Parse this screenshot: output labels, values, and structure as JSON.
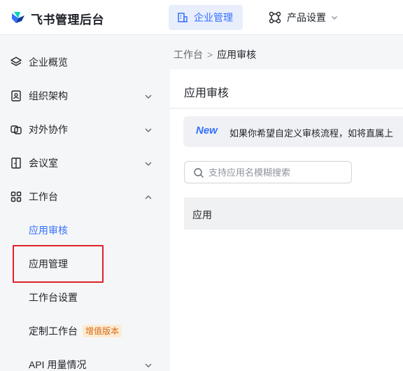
{
  "app": {
    "brand": "飞书管理后台",
    "colors": {
      "accent": "#3370ff",
      "highlight": "#e0212a",
      "badge_text": "#d4690f"
    }
  },
  "topnav": {
    "tabs": [
      {
        "label": "企业管理",
        "icon": "building-icon",
        "active": true
      },
      {
        "label": "产品设置",
        "icon": "nodes-icon",
        "active": false
      }
    ]
  },
  "sidebar": {
    "items": [
      {
        "label": "企业概览",
        "icon": "layers-icon"
      },
      {
        "label": "组织架构",
        "icon": "contact-card-icon",
        "expanded": false
      },
      {
        "label": "对外协作",
        "icon": "link-squares-icon",
        "expanded": false
      },
      {
        "label": "会议室",
        "icon": "door-icon",
        "expanded": false
      },
      {
        "label": "工作台",
        "icon": "grid-icon",
        "expanded": true
      },
      {
        "label": "API 用量情况",
        "expanded": false
      }
    ],
    "workspace_children": [
      {
        "label": "应用审核",
        "selected": true
      },
      {
        "label": "应用管理"
      },
      {
        "label": "工作台设置"
      },
      {
        "label": "定制工作台",
        "badge": "增值版本"
      }
    ]
  },
  "main": {
    "breadcrumb": {
      "parent": "工作台",
      "separator": ">",
      "current": "应用审核"
    },
    "title": "应用审核",
    "notice": {
      "tag": "New",
      "text": "如果你希望自定义审核流程，如将直属上"
    },
    "search": {
      "placeholder": "支持应用名模糊搜索",
      "value": ""
    },
    "table": {
      "columns": [
        "应用"
      ]
    }
  }
}
